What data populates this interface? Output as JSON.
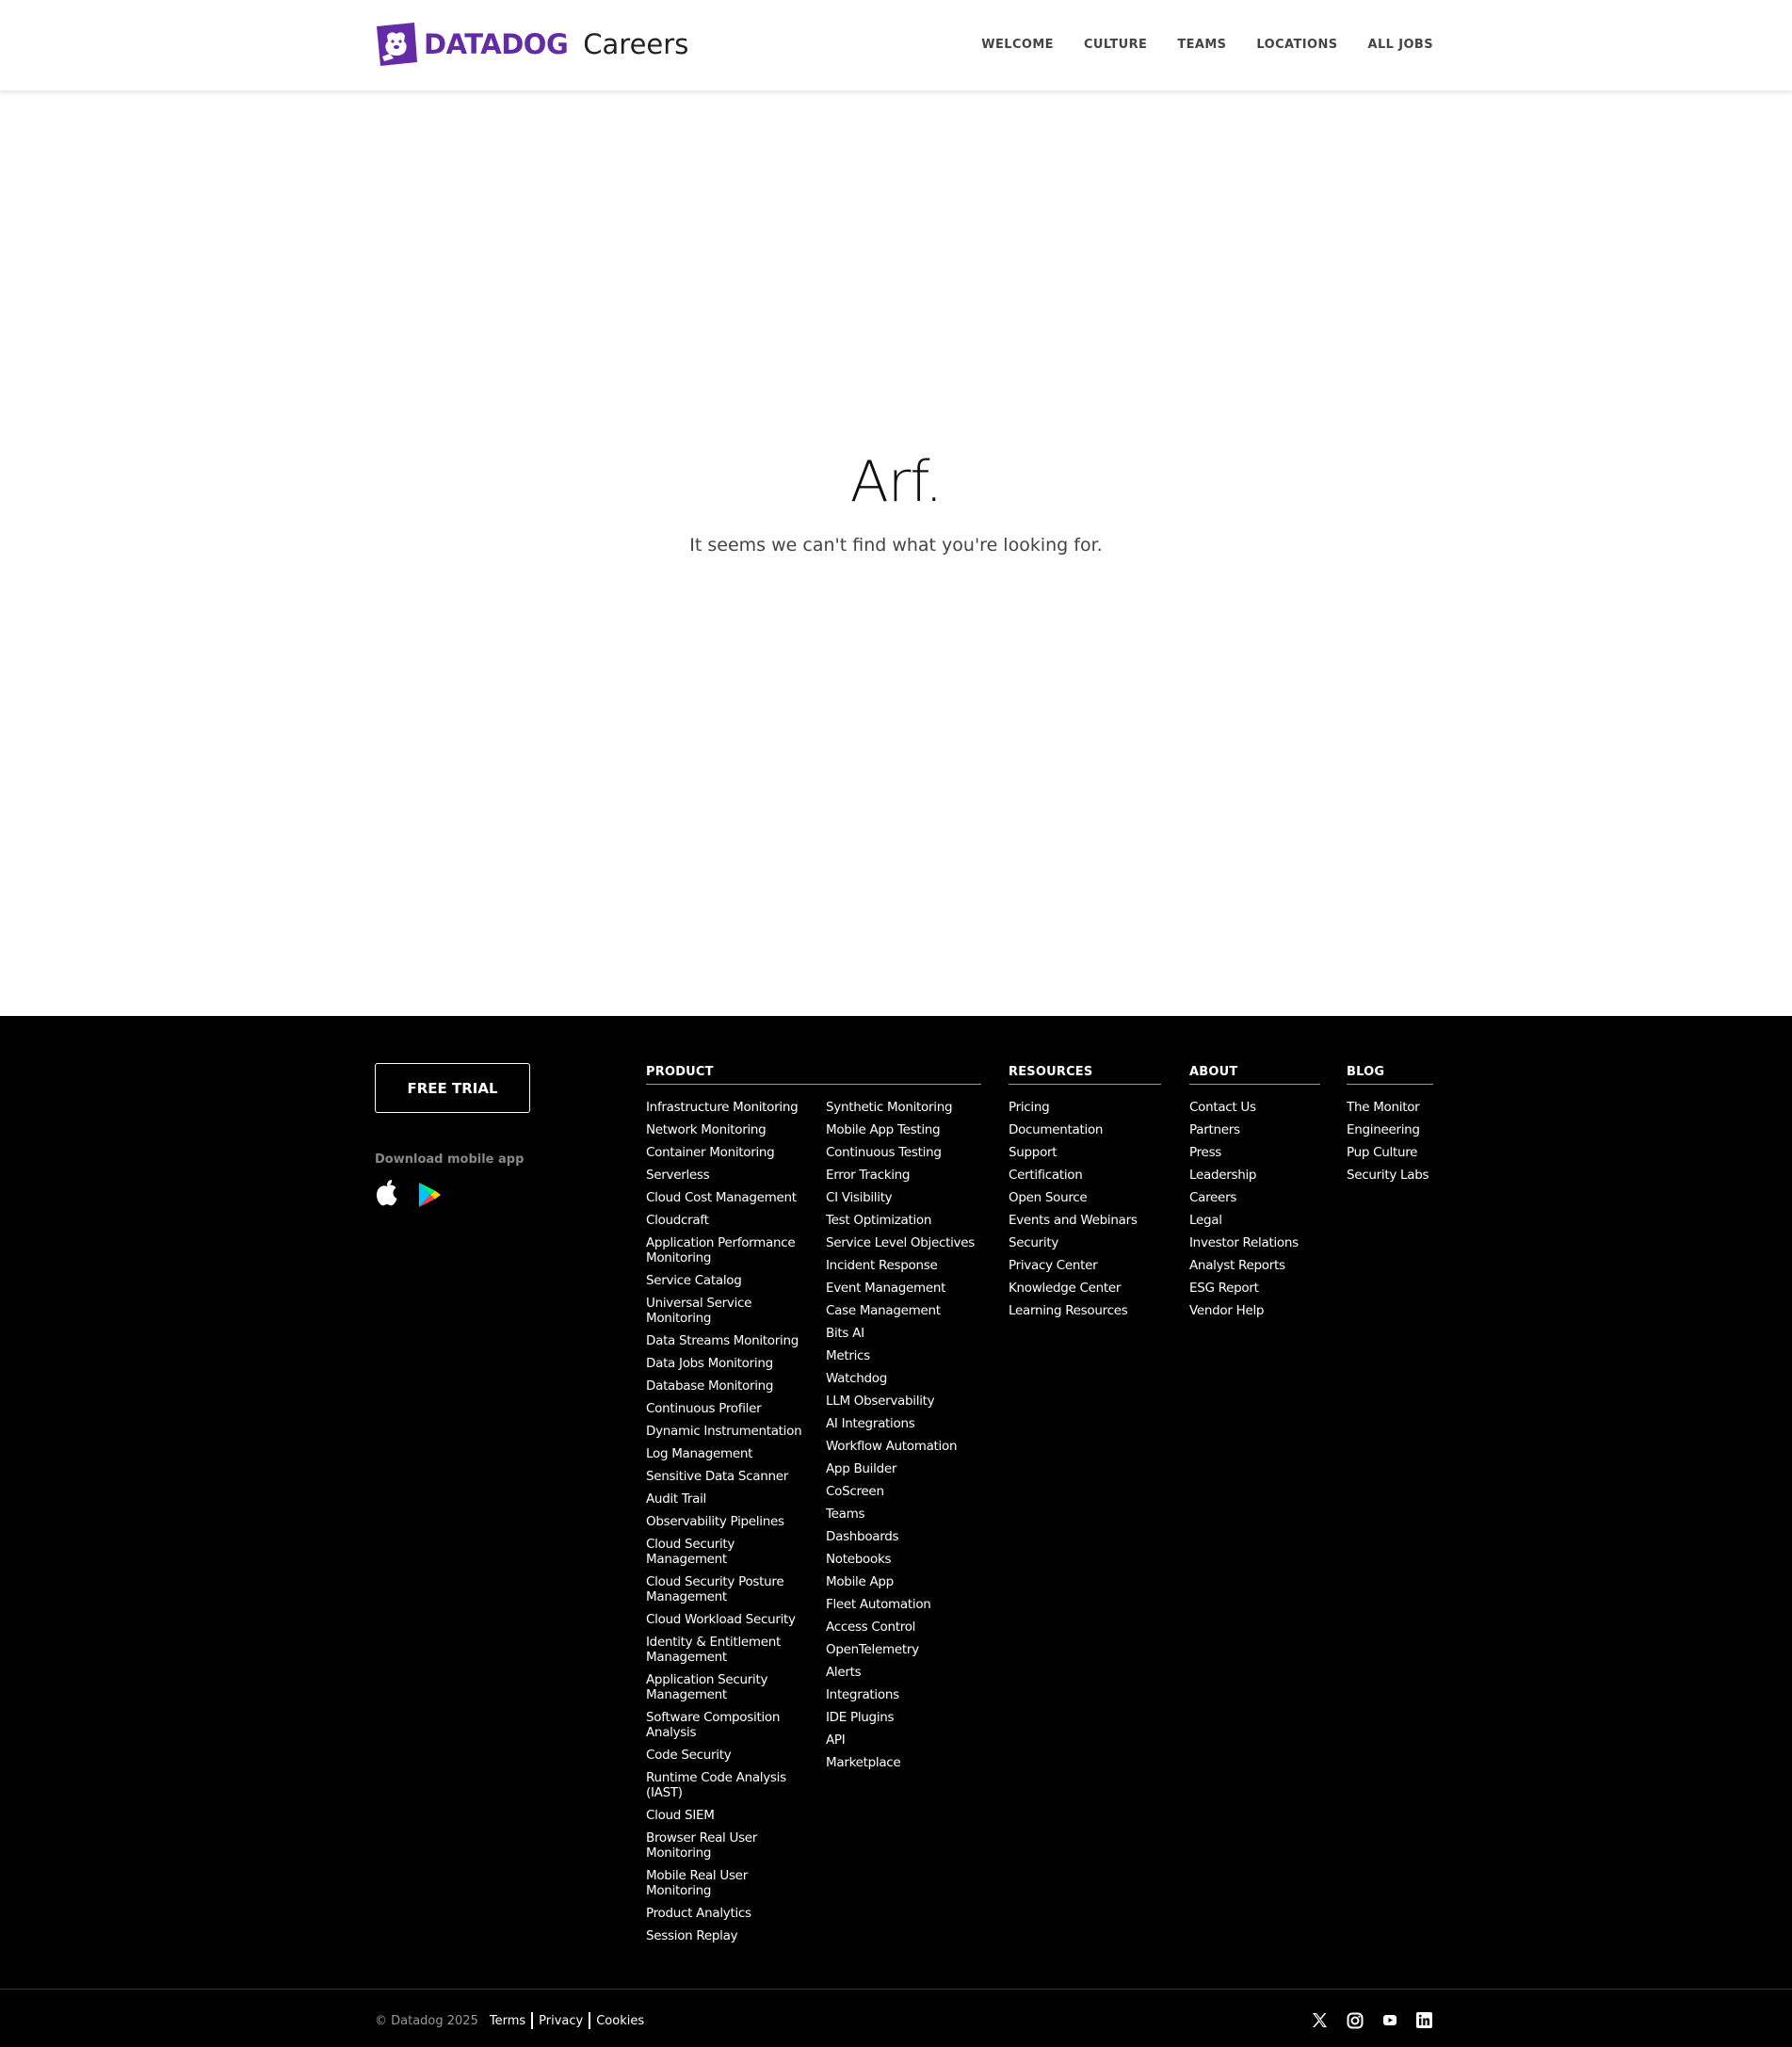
{
  "header": {
    "logo_text": "DATADOG",
    "logo_suffix": "Careers",
    "nav": [
      "WELCOME",
      "CULTURE",
      "TEAMS",
      "LOCATIONS",
      "ALL JOBS"
    ]
  },
  "main": {
    "title": "Arf.",
    "subtitle": "It seems we can't find what you're looking for."
  },
  "footer": {
    "free_trial": "FREE TRIAL",
    "mobile_label": "Download mobile app",
    "mobile_icons": [
      "apple-icon",
      "google-play-icon"
    ],
    "product": {
      "heading": "PRODUCT",
      "col1": [
        "Infrastructure Monitoring",
        "Network Monitoring",
        "Container Monitoring",
        "Serverless",
        "Cloud Cost Management",
        "Cloudcraft",
        "Application Performance Monitoring",
        "Service Catalog",
        "Universal Service Monitoring",
        "Data Streams Monitoring",
        "Data Jobs Monitoring",
        "Database Monitoring",
        "Continuous Profiler",
        "Dynamic Instrumentation",
        "Log Management",
        "Sensitive Data Scanner",
        "Audit Trail",
        "Observability Pipelines",
        "Cloud Security Management",
        "Cloud Security Posture Management",
        "Cloud Workload Security",
        "Identity & Entitlement Management",
        "Application Security Management",
        "Software Composition Analysis",
        "Code Security",
        "Runtime Code Analysis (IAST)",
        "Cloud SIEM",
        "Browser Real User Monitoring",
        "Mobile Real User Monitoring",
        "Product Analytics",
        "Session Replay"
      ],
      "col2": [
        "Synthetic Monitoring",
        "Mobile App Testing",
        "Continuous Testing",
        "Error Tracking",
        "CI Visibility",
        "Test Optimization",
        "Service Level Objectives",
        "Incident Response",
        "Event Management",
        "Case Management",
        "Bits AI",
        "Metrics",
        "Watchdog",
        "LLM Observability",
        "AI Integrations",
        "Workflow Automation",
        "App Builder",
        "CoScreen",
        "Teams",
        "Dashboards",
        "Notebooks",
        "Mobile App",
        "Fleet Automation",
        "Access Control",
        "OpenTelemetry",
        "Alerts",
        "Integrations",
        "IDE Plugins",
        "API",
        "Marketplace"
      ]
    },
    "resources": {
      "heading": "RESOURCES",
      "items": [
        "Pricing",
        "Documentation",
        "Support",
        "Certification",
        "Open Source",
        "Events and Webinars",
        "Security",
        "Privacy Center",
        "Knowledge Center",
        "Learning Resources"
      ]
    },
    "about": {
      "heading": "ABOUT",
      "items": [
        "Contact Us",
        "Partners",
        "Press",
        "Leadership",
        "Careers",
        "Legal",
        "Investor Relations",
        "Analyst Reports",
        "ESG Report",
        "Vendor Help"
      ]
    },
    "blog": {
      "heading": "BLOG",
      "items": [
        "The Monitor",
        "Engineering",
        "Pup Culture",
        "Security Labs"
      ]
    },
    "copyright": "© Datadog 2025",
    "legal": [
      "Terms",
      "Privacy",
      "Cookies"
    ],
    "social": [
      "x-icon",
      "instagram-icon",
      "youtube-icon",
      "linkedin-icon"
    ]
  },
  "colors": {
    "brand_purple": "#632ca6",
    "footer_bg": "#000000",
    "text_muted": "#999999"
  }
}
